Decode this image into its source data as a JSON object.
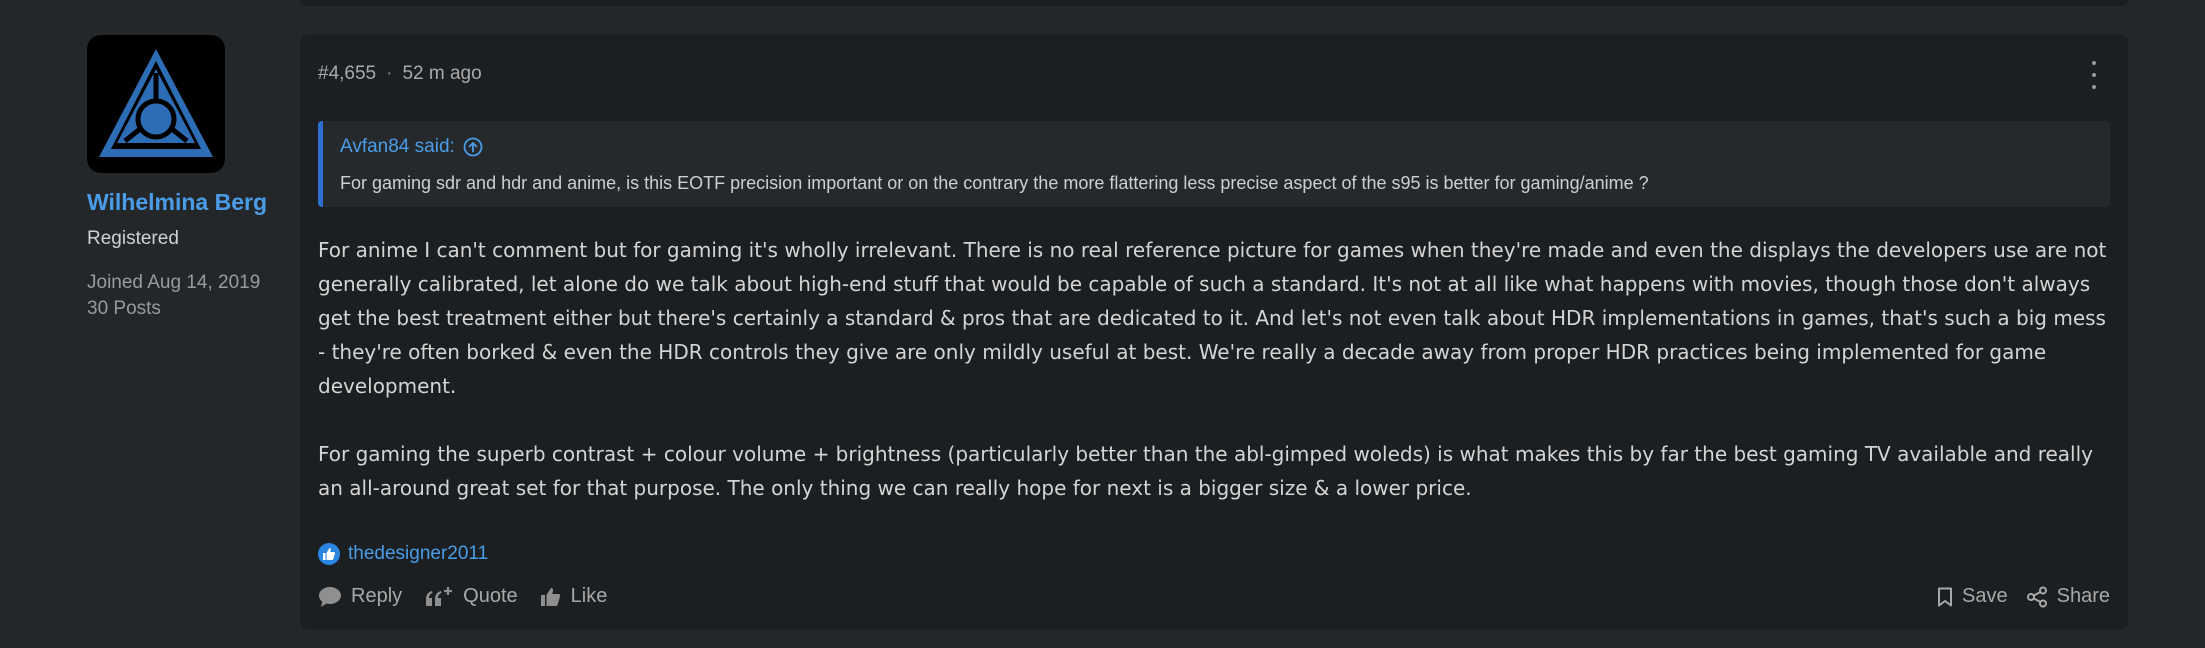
{
  "user": {
    "name": "Wilhelmina Berg",
    "title": "Registered",
    "joined": "Joined Aug 14, 2019",
    "posts": "30 Posts",
    "avatar_icon": "triangle-emblem-icon"
  },
  "post": {
    "number": "#4,655",
    "separator": "·",
    "time": "52 m ago",
    "quote": {
      "author": "Avfan84 said:",
      "text": "For gaming sdr and hdr and anime, is this EOTF precision important or on the contrary the more flattering less precise aspect of the s95 is better for gaming/anime ?"
    },
    "paragraphs": [
      "For anime I can't comment but for gaming it's wholly irrelevant. There is no real reference picture for games when they're made and even the displays the developers use are not generally calibrated, let alone do we talk about high-end stuff that would be capable of such a standard. It's not at all like what happens with movies, though those don't always get the best treatment either but there's certainly a standard & pros that are dedicated to it. And let's not even talk about HDR implementations in games, that's such a big mess - they're often borked & even the HDR controls they give are only mildly useful at best. We're really a decade away from proper HDR practices being implemented for game development.",
      "For gaming the superb contrast + colour volume + brightness (particularly better than the abl-gimped woleds) is what makes this by far the best gaming TV available and really an all-around great set for that purpose. The only thing we can really hope for next is a bigger size & a lower price."
    ],
    "reaction_user": "thedesigner2011"
  },
  "actions": {
    "reply": "Reply",
    "quote": "Quote",
    "like": "Like",
    "save": "Save",
    "share": "Share"
  },
  "colors": {
    "accent": "#4a9ce8",
    "background": "#23272a",
    "card": "#1c1f21",
    "quote_bar": "#2f6fd0"
  }
}
